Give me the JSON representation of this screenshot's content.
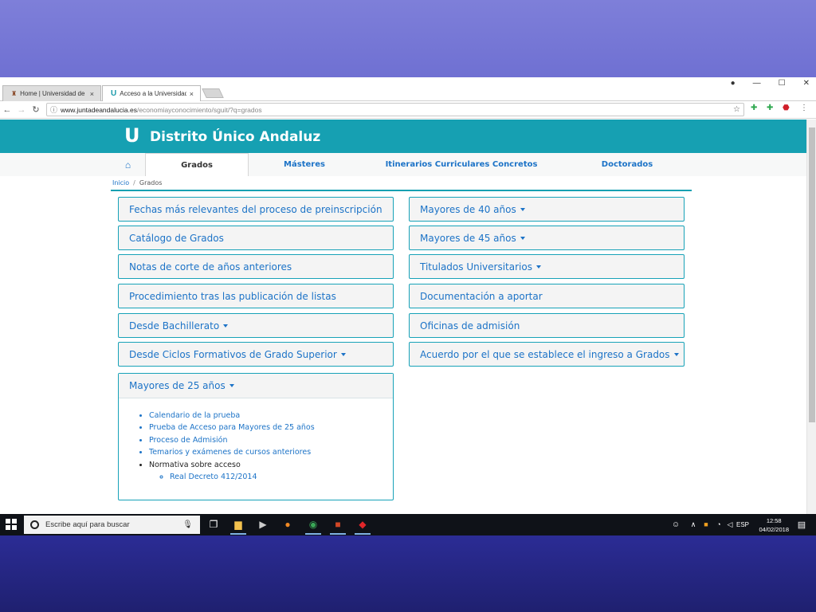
{
  "browser": {
    "tabs": [
      {
        "label": "Home | Universidad de G",
        "close": "×"
      },
      {
        "label": "Acceso a la Universidad",
        "close": "×"
      }
    ],
    "window_controls": {
      "profile": "●",
      "minimize": "—",
      "maximize": "☐",
      "close": "✕"
    },
    "url_host": "www.juntadeandalucia.es",
    "url_path": "/economiayconocimiento/sguit/?q=grados"
  },
  "site": {
    "logo": "U",
    "title": "Distrito Único Andaluz"
  },
  "nav": {
    "items": [
      "Grados",
      "Másteres",
      "Itinerarios Curriculares Concretos",
      "Doctorados"
    ],
    "active": "Grados"
  },
  "breadcrumb": {
    "home": "Inicio",
    "separator": "/",
    "current": "Grados"
  },
  "left_buttons": [
    {
      "label": "Fechas más relevantes del proceso de preinscripción",
      "dropdown": false
    },
    {
      "label": "Catálogo de Grados",
      "dropdown": false
    },
    {
      "label": "Notas de corte de años anteriores",
      "dropdown": false
    },
    {
      "label": "Procedimiento tras las publicación de listas",
      "dropdown": false
    },
    {
      "label": "Desde Bachillerato",
      "dropdown": true
    },
    {
      "label": "Desde Ciclos Formativos de Grado Superior",
      "dropdown": true
    }
  ],
  "right_buttons": [
    {
      "label": "Mayores de 40 años",
      "dropdown": true
    },
    {
      "label": "Mayores de 45 años",
      "dropdown": true
    },
    {
      "label": "Titulados Universitarios",
      "dropdown": true
    },
    {
      "label": "Documentación a aportar",
      "dropdown": false
    },
    {
      "label": "Oficinas de admisión",
      "dropdown": false
    },
    {
      "label": "Acuerdo por el que se establece el ingreso a Grados",
      "dropdown": true
    }
  ],
  "expanded_panel": {
    "title": "Mayores de 25 años",
    "items": [
      "Calendario de la prueba",
      "Prueba de Acceso para Mayores de 25 años",
      "Proceso de Admisión",
      "Temarios y exámenes de cursos anteriores",
      "Normativa sobre acceso"
    ],
    "sub_items": [
      "Real Decreto 412/2014"
    ]
  },
  "taskbar": {
    "search_placeholder": "Escribe aquí para buscar",
    "language": "ESP",
    "time": "12:58",
    "date": "04/02/2018"
  },
  "colors": {
    "header_teal": "#16a0b2",
    "link_blue": "#1c73c7",
    "slide_top": "#7e7fd9",
    "slide_bottom": "#2b2c95"
  }
}
